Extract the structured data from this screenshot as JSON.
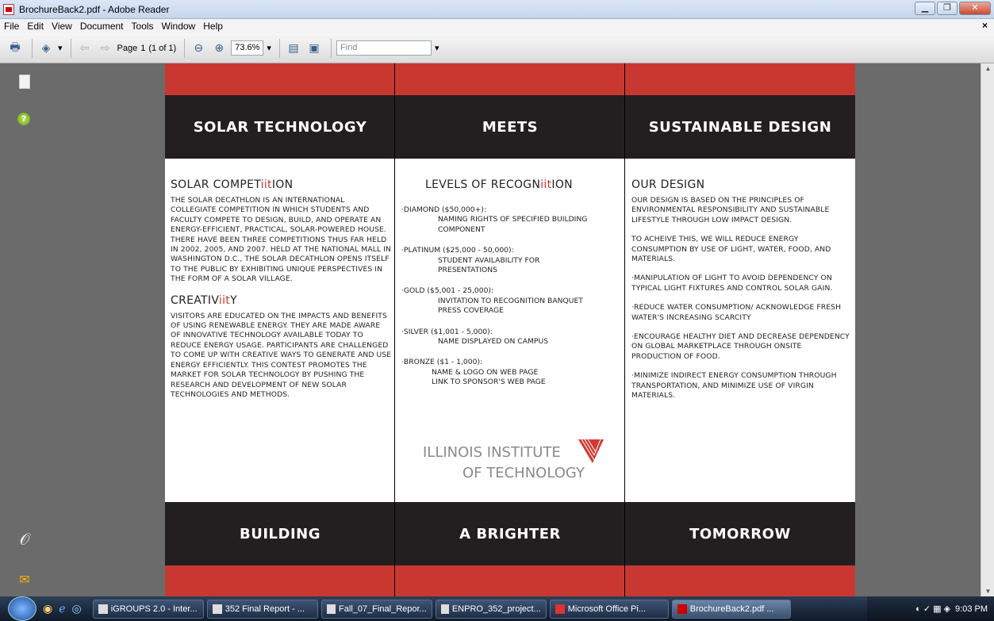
{
  "window": {
    "title": "BrochureBack2.pdf - Adobe Reader",
    "buttons": {
      "minimize": "▁",
      "maximize": "❐",
      "close": "✕"
    }
  },
  "menubar": {
    "items": [
      "File",
      "Edit",
      "View",
      "Document",
      "Tools",
      "Window",
      "Help"
    ],
    "close_doc": "×"
  },
  "toolbar": {
    "page_label": "Page",
    "page_value": "1",
    "page_count": "(1 of 1)",
    "zoom_value": "73.6%",
    "find_placeholder": "Find"
  },
  "document": {
    "header": [
      "SOLAR TECHNOLOGY",
      "MEETS",
      "SUSTAINABLE DESIGN"
    ],
    "footer": [
      "BUILDING",
      "A BRIGHTER",
      "TOMORROW"
    ],
    "col1": {
      "h1_pre": "SOLAR COMPET",
      "h1_red": "iit",
      "h1_post": "ION",
      "p1": "The Solar Decathlon is an international collegiate competition in which students and faculty compete to design, build, and operate an energy-efficient, practical, solar-powered house.  There have been three competitions thus far held in 2002, 2005, and 2007.  Held at the National Mall in Washington D.C., the Solar Decathlon opens itself to the public by exhibiting unique perspectives in the form of a solar village.",
      "h2_pre": "CREATIV",
      "h2_red": "iit",
      "h2_post": "Y",
      "p2": "Visitors are educated on the impacts and benefits of using renewable energy.  They are made aware of innovative technology available today to reduce energy usage. Participants are challenged to come up with creative ways to generate and use energy efficiently.  This contest promotes the market for solar technology by pushing the research and development of new solar technologies and methods."
    },
    "col2": {
      "h_pre": "LEVELS OF RECOGN",
      "h_red": "iit",
      "h_post": "ION",
      "levels": [
        {
          "name": "·Diamond ($50,000+):",
          "benefits": [
            "Naming rights of specified building",
            "component"
          ]
        },
        {
          "name": "·Platinum ($25,000 - 50,000):",
          "benefits": [
            "Student Availability for",
            "presentations"
          ]
        },
        {
          "name": "·Gold ($5,001 - 25,000):",
          "benefits": [
            "Invitation to recognition banquet",
            "Press coverage"
          ]
        },
        {
          "name": "·Silver ($1,001 - 5,000):",
          "benefits": [
            "Name displayed on campus"
          ]
        },
        {
          "name": "·Bronze ($1 - 1,000):",
          "benefits": [
            "Name & logo on web page",
            "Link to sponsor's web page"
          ]
        }
      ],
      "logo_line1": "ILLINOIS INSTITUTE",
      "logo_line2": "OF TECHNOLOGY"
    },
    "col3": {
      "heading": "OUR DESIGN",
      "paras": [
        "Our design is based on the principles of environmental responsibility and sustainable lifestyle through low impact design.",
        "To acheive this, we will reduce energy consumption by use of light, water, food, and materials.",
        "·Manipulation of light to avoid dependency on typical light fixtures and control solar gain.",
        "·Reduce water consumption/ acknowledge fresh water's increasing scarcity",
        "·Encourage healthy diet and decrease dependency on global marketplace through onsite production of food.",
        "·Minimize indirect energy consumption through transportation, and minimize use of virgin materials."
      ]
    }
  },
  "taskbar": {
    "items": [
      "iGROUPS 2.0 - Inter...",
      "352 Final Report - ...",
      "Fall_07_Final_Repor...",
      "ENPRO_352_project...",
      "Microsoft Office Pi...",
      "BrochureBack2.pdf ..."
    ],
    "clock": "9:03 PM"
  }
}
